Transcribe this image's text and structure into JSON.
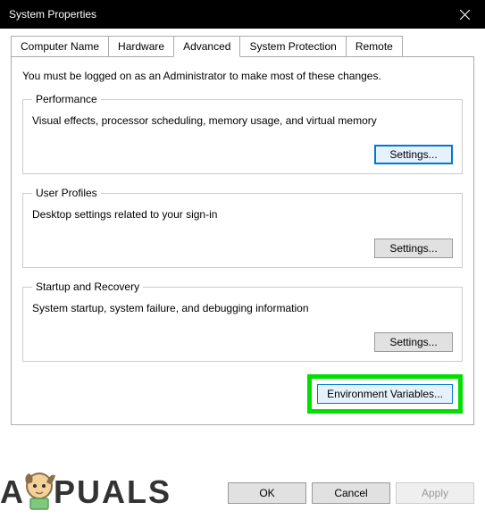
{
  "window": {
    "title": "System Properties"
  },
  "tabs": {
    "items": [
      {
        "label": "Computer Name"
      },
      {
        "label": "Hardware"
      },
      {
        "label": "Advanced"
      },
      {
        "label": "System Protection"
      },
      {
        "label": "Remote"
      }
    ],
    "active_index": 2
  },
  "advanced": {
    "intro": "You must be logged on as an Administrator to make most of these changes.",
    "performance": {
      "legend": "Performance",
      "description": "Visual effects, processor scheduling, memory usage, and virtual memory",
      "button": "Settings..."
    },
    "user_profiles": {
      "legend": "User Profiles",
      "description": "Desktop settings related to your sign-in",
      "button": "Settings..."
    },
    "startup_recovery": {
      "legend": "Startup and Recovery",
      "description": "System startup, system failure, and debugging information",
      "button": "Settings..."
    },
    "env_vars_button": "Environment Variables..."
  },
  "footer": {
    "ok": "OK",
    "cancel": "Cancel",
    "apply": "Apply"
  },
  "watermark": {
    "prefix": "A",
    "suffix": "PUALS"
  }
}
